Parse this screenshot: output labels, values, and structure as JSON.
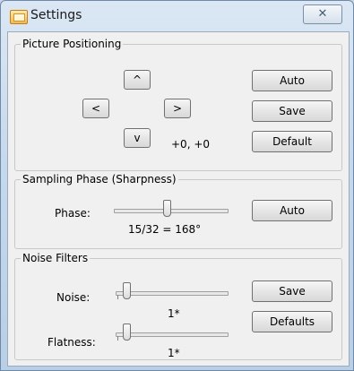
{
  "window": {
    "title": "Settings",
    "close_glyph": "✕"
  },
  "picture_positioning": {
    "title": "Picture Positioning",
    "up": "^",
    "left": "<",
    "right": ">",
    "down": "v",
    "offset": "+0, +0",
    "auto": "Auto",
    "save": "Save",
    "default": "Default"
  },
  "sampling_phase": {
    "title": "Sampling Phase (Sharpness)",
    "phase_label": "Phase:",
    "phase_value": "15/32 = 168°",
    "phase_level": 0.47,
    "auto": "Auto"
  },
  "noise_filters": {
    "title": "Noise Filters",
    "noise_label": "Noise:",
    "noise_value": "1*",
    "noise_level": 0.1,
    "flatness_label": "Flatness:",
    "flatness_value": "1*",
    "flatness_level": 0.1,
    "save": "Save",
    "defaults": "Defaults"
  },
  "icons": {
    "app": "settings-window-icon",
    "close": "close-icon"
  }
}
